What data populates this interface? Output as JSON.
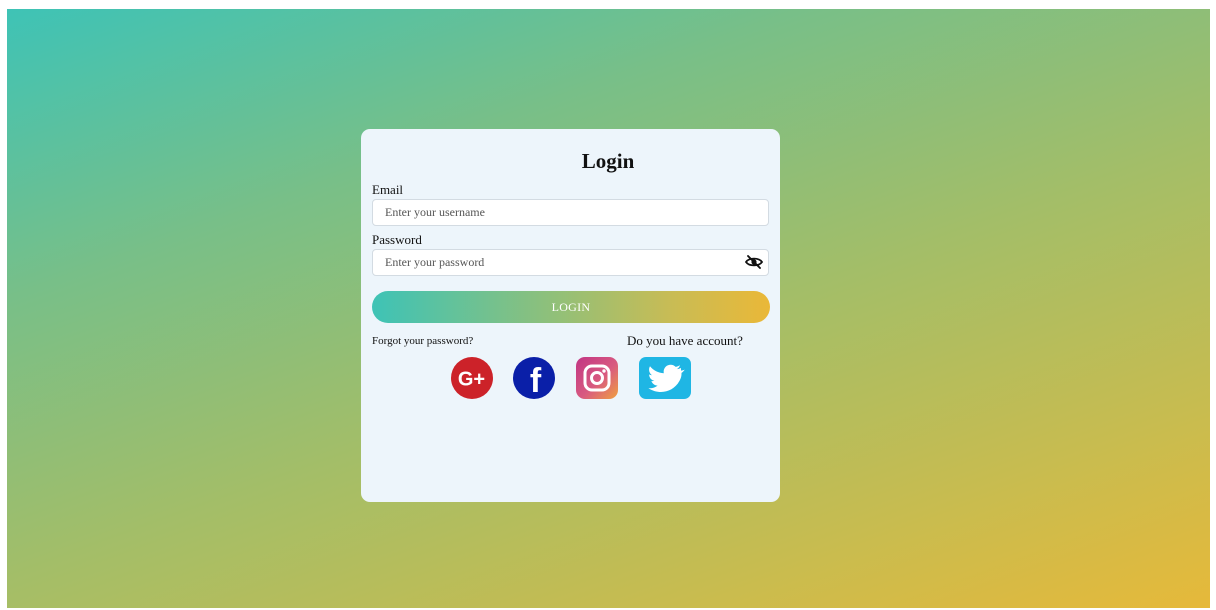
{
  "form": {
    "title": "Login",
    "email_label": "Email",
    "email_placeholder": "Enter your username",
    "password_label": "Password",
    "password_placeholder": "Enter your password",
    "login_button": "LOGIN",
    "forgot_link": "Forgot your password?",
    "account_link": "Do you have account?"
  },
  "social": {
    "google_text": "G+",
    "facebook_text": "f"
  },
  "colors": {
    "gradient_start": "#3ec3b6",
    "gradient_end": "#e6b93a",
    "card_background": "#edf5fb",
    "google": "#cc2229",
    "facebook": "#0a1fa8",
    "instagram_start": "#c13584",
    "instagram_end": "#f0a040",
    "twitter": "#1fb6e4"
  }
}
